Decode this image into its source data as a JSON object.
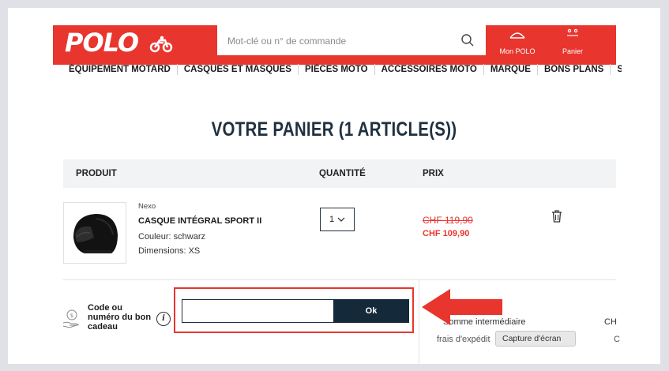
{
  "header": {
    "logo_text": "POLO",
    "search_placeholder": "Mot-clé ou n° de commande",
    "account_label": "Mon POLO",
    "cart_label": "Panier"
  },
  "nav": {
    "items": [
      "ÉQUIPEMENT MOTARD",
      "CASQUES ET MASQUES",
      "PIÈCES MOTO",
      "ACCESSOIRES MOTO",
      "MARQUE",
      "BONS PLANS",
      "SERVICE &"
    ]
  },
  "page": {
    "title": "VOTRE PANIER (1 ARTICLE(S))"
  },
  "table": {
    "headers": {
      "product": "PRODUIT",
      "quantity": "QUANTITÉ",
      "price": "PRIX"
    }
  },
  "item": {
    "brand": "Nexo",
    "name": "CASQUE INTÉGRAL SPORT II",
    "color": "Couleur: schwarz",
    "size": "Dimensions: XS",
    "quantity": "1",
    "old_price": "CHF 119,90",
    "new_price": "CHF 109,90"
  },
  "voucher": {
    "label_line1": "Code ou",
    "label_line2": "numéro du bon",
    "label_line3": "cadeau",
    "info": "i",
    "input_value": "",
    "button_label": "Ok"
  },
  "summary": {
    "subtotal_label": "Somme intermédiaire",
    "subtotal_value": "CH",
    "shipping_label": "frais d'expédit",
    "shipping_value": "C"
  },
  "tooltip": {
    "text": "Capture d'écran"
  },
  "colors": {
    "brand_red": "#e8352e",
    "navy": "#14293a",
    "background": "#dfe1e7"
  }
}
